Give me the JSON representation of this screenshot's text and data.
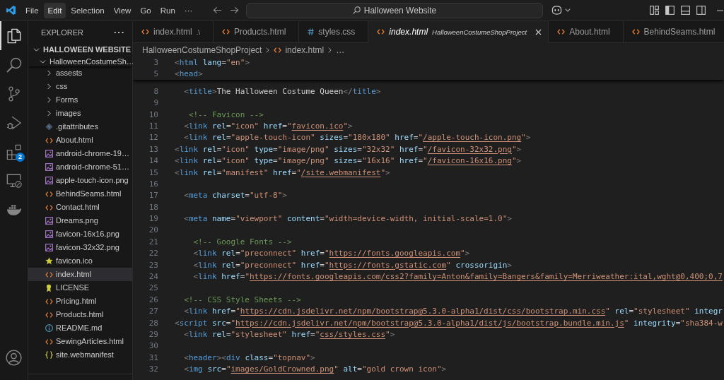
{
  "title_bar": {
    "menu": [
      {
        "label": "File",
        "selected": false
      },
      {
        "label": "Edit",
        "selected": true
      },
      {
        "label": "Selection",
        "selected": false
      },
      {
        "label": "View",
        "selected": false
      },
      {
        "label": "Go",
        "selected": false
      },
      {
        "label": "Run",
        "selected": false
      },
      {
        "label": "···",
        "selected": false
      }
    ],
    "command_center": {
      "label": "Halloween Website"
    }
  },
  "activity_bar": {
    "items": [
      {
        "kind": "explorer",
        "selected": true
      },
      {
        "kind": "search",
        "selected": false
      },
      {
        "kind": "source-control",
        "selected": false
      },
      {
        "kind": "run-debug",
        "selected": false
      },
      {
        "kind": "extensions",
        "selected": false,
        "badge": "2"
      },
      {
        "kind": "remote-explorer",
        "selected": false
      },
      {
        "kind": "docker",
        "selected": false
      }
    ]
  },
  "sidebar": {
    "title": "EXPLORER",
    "more_actions": "···",
    "tree": {
      "label": "HALLOWEEN WEBSITE",
      "kind": "workspace",
      "expanded": true,
      "children": [
        {
          "label": "HalloweenCostumeSh…",
          "kind": "folder",
          "expanded": true,
          "selected": false,
          "children": [
            {
              "label": "assests",
              "kind": "folder",
              "expanded": false,
              "selected": false
            },
            {
              "label": "css",
              "kind": "folder",
              "expanded": false,
              "selected": false
            },
            {
              "label": "Forms",
              "kind": "folder",
              "expanded": false,
              "selected": false
            },
            {
              "label": "images",
              "kind": "folder",
              "expanded": false,
              "selected": false
            },
            {
              "label": ".gitattributes",
              "kind": "git",
              "selected": false
            },
            {
              "label": "About.html",
              "kind": "html",
              "selected": false
            },
            {
              "label": "android-chrome-19…",
              "kind": "image",
              "selected": false
            },
            {
              "label": "android-chrome-51…",
              "kind": "image",
              "selected": false
            },
            {
              "label": "apple-touch-icon.png",
              "kind": "image",
              "selected": false
            },
            {
              "label": "BehindSeams.html",
              "kind": "html",
              "selected": false
            },
            {
              "label": "Contact.html",
              "kind": "html",
              "selected": false
            },
            {
              "label": "Dreams.png",
              "kind": "image",
              "selected": false
            },
            {
              "label": "favicon-16x16.png",
              "kind": "image",
              "selected": false
            },
            {
              "label": "favicon-32x32.png",
              "kind": "image",
              "selected": false
            },
            {
              "label": "favicon.ico",
              "kind": "favicon",
              "selected": false
            },
            {
              "label": "index.html",
              "kind": "html",
              "selected": true
            },
            {
              "label": "LICENSE",
              "kind": "license",
              "selected": false
            },
            {
              "label": "Pricing.html",
              "kind": "html",
              "selected": false
            },
            {
              "label": "Products.html",
              "kind": "html",
              "selected": false
            },
            {
              "label": "README.md",
              "kind": "readme",
              "selected": false
            },
            {
              "label": "SewingArticles.html",
              "kind": "html",
              "selected": false
            },
            {
              "label": "site.webmanifest",
              "kind": "manifest",
              "selected": false
            }
          ]
        }
      ]
    }
  },
  "tabs": [
    {
      "label": "index.html",
      "description": ".\\",
      "kind": "html",
      "selected": false,
      "preview": false
    },
    {
      "label": "Products.html",
      "kind": "html",
      "selected": false,
      "preview": false
    },
    {
      "label": "styles.css",
      "kind": "css",
      "selected": false,
      "preview": false
    },
    {
      "label": "index.html",
      "description": "HalloweenCostumeShopProject",
      "kind": "html",
      "selected": true,
      "preview": true
    },
    {
      "label": "About.html",
      "kind": "html",
      "selected": false,
      "preview": false
    },
    {
      "label": "BehindSeams.html",
      "kind": "html",
      "selected": false,
      "preview": false
    }
  ],
  "breadcrumb": [
    {
      "label": "HalloweenCostumeShopProject",
      "kind": "folder"
    },
    {
      "label": "index.html",
      "kind": "html"
    },
    {
      "label": "…",
      "kind": "more"
    }
  ],
  "editor": {
    "sticky_lines": [
      {
        "number": "3",
        "tokens": [
          {
            "kind": "bracket",
            "text": "<"
          },
          {
            "kind": "tag",
            "text": "html "
          },
          {
            "kind": "attribute",
            "text": "lang"
          },
          {
            "kind": "plain",
            "text": "="
          },
          {
            "kind": "string",
            "text": "\"en\""
          },
          {
            "kind": "bracket",
            "text": ">"
          }
        ]
      },
      {
        "number": "5",
        "tokens": [
          {
            "kind": "bracket",
            "text": "<"
          },
          {
            "kind": "tag",
            "text": "head"
          },
          {
            "kind": "bracket",
            "text": ">"
          }
        ]
      }
    ],
    "lines": [
      {
        "number": "8",
        "tokens": [
          {
            "kind": "bracket",
            "text": "  <"
          },
          {
            "kind": "tag",
            "text": "title"
          },
          {
            "kind": "bracket",
            "text": ">"
          },
          {
            "kind": "plain",
            "text": "The Halloween Costume Queen"
          },
          {
            "kind": "bracket",
            "text": "</"
          },
          {
            "kind": "tag",
            "text": "title"
          },
          {
            "kind": "bracket",
            "text": ">"
          }
        ]
      },
      {
        "number": "9"
      },
      {
        "number": "10",
        "tokens": [
          {
            "kind": "comment",
            "text": "   <!-- Favicon -->"
          }
        ]
      },
      {
        "number": "11",
        "tokens": [
          {
            "kind": "bracket",
            "text": "  <"
          },
          {
            "kind": "tag",
            "text": "link "
          },
          {
            "kind": "attribute",
            "text": "rel"
          },
          {
            "kind": "plain",
            "text": "="
          },
          {
            "kind": "string",
            "text": "\"icon\" "
          },
          {
            "kind": "attribute",
            "text": "href"
          },
          {
            "kind": "plain",
            "text": "="
          },
          {
            "kind": "string",
            "text": "\""
          },
          {
            "kind": "link",
            "text": "favicon.ico"
          },
          {
            "kind": "string",
            "text": "\""
          },
          {
            "kind": "bracket",
            "text": ">"
          }
        ]
      },
      {
        "number": "12",
        "tokens": [
          {
            "kind": "bracket",
            "text": "  <"
          },
          {
            "kind": "tag",
            "text": "link "
          },
          {
            "kind": "attribute",
            "text": "rel"
          },
          {
            "kind": "plain",
            "text": "="
          },
          {
            "kind": "string",
            "text": "\"apple-touch-icon\" "
          },
          {
            "kind": "attribute",
            "text": "sizes"
          },
          {
            "kind": "plain",
            "text": "="
          },
          {
            "kind": "string",
            "text": "\"180x180\" "
          },
          {
            "kind": "attribute",
            "text": "href"
          },
          {
            "kind": "plain",
            "text": "="
          },
          {
            "kind": "string",
            "text": "\""
          },
          {
            "kind": "link",
            "text": "/apple-touch-icon.png"
          },
          {
            "kind": "string",
            "text": "\""
          },
          {
            "kind": "bracket",
            "text": ">"
          }
        ]
      },
      {
        "number": "13",
        "tokens": [
          {
            "kind": "bracket",
            "text": "<"
          },
          {
            "kind": "tag",
            "text": "link "
          },
          {
            "kind": "attribute",
            "text": "rel"
          },
          {
            "kind": "plain",
            "text": "="
          },
          {
            "kind": "string",
            "text": "\"icon\" "
          },
          {
            "kind": "attribute",
            "text": "type"
          },
          {
            "kind": "plain",
            "text": "="
          },
          {
            "kind": "string",
            "text": "\"image/png\" "
          },
          {
            "kind": "attribute",
            "text": "sizes"
          },
          {
            "kind": "plain",
            "text": "="
          },
          {
            "kind": "string",
            "text": "\"32x32\" "
          },
          {
            "kind": "attribute",
            "text": "href"
          },
          {
            "kind": "plain",
            "text": "="
          },
          {
            "kind": "string",
            "text": "\""
          },
          {
            "kind": "link",
            "text": "/favicon-32x32.png"
          },
          {
            "kind": "string",
            "text": "\""
          },
          {
            "kind": "bracket",
            "text": ">"
          }
        ]
      },
      {
        "number": "14",
        "tokens": [
          {
            "kind": "bracket",
            "text": "<"
          },
          {
            "kind": "tag",
            "text": "link "
          },
          {
            "kind": "attribute",
            "text": "rel"
          },
          {
            "kind": "plain",
            "text": "="
          },
          {
            "kind": "string",
            "text": "\"icon\" "
          },
          {
            "kind": "attribute",
            "text": "type"
          },
          {
            "kind": "plain",
            "text": "="
          },
          {
            "kind": "string",
            "text": "\"image/png\" "
          },
          {
            "kind": "attribute",
            "text": "sizes"
          },
          {
            "kind": "plain",
            "text": "="
          },
          {
            "kind": "string",
            "text": "\"16x16\" "
          },
          {
            "kind": "attribute",
            "text": "href"
          },
          {
            "kind": "plain",
            "text": "="
          },
          {
            "kind": "string",
            "text": "\""
          },
          {
            "kind": "link",
            "text": "/favicon-16x16.png"
          },
          {
            "kind": "string",
            "text": "\""
          },
          {
            "kind": "bracket",
            "text": ">"
          }
        ]
      },
      {
        "number": "15",
        "tokens": [
          {
            "kind": "bracket",
            "text": "<"
          },
          {
            "kind": "tag",
            "text": "link "
          },
          {
            "kind": "attribute",
            "text": "rel"
          },
          {
            "kind": "plain",
            "text": "="
          },
          {
            "kind": "string",
            "text": "\"manifest\" "
          },
          {
            "kind": "attribute",
            "text": "href"
          },
          {
            "kind": "plain",
            "text": "="
          },
          {
            "kind": "string",
            "text": "\""
          },
          {
            "kind": "link",
            "text": "/site.webmanifest"
          },
          {
            "kind": "string",
            "text": "\""
          },
          {
            "kind": "bracket",
            "text": ">"
          }
        ]
      },
      {
        "number": "16"
      },
      {
        "number": "17",
        "tokens": [
          {
            "kind": "bracket",
            "text": "  <"
          },
          {
            "kind": "tag",
            "text": "meta "
          },
          {
            "kind": "attribute",
            "text": "charset"
          },
          {
            "kind": "plain",
            "text": "="
          },
          {
            "kind": "string",
            "text": "\"utf-8\""
          },
          {
            "kind": "bracket",
            "text": ">"
          }
        ]
      },
      {
        "number": "18"
      },
      {
        "number": "19",
        "tokens": [
          {
            "kind": "bracket",
            "text": "  <"
          },
          {
            "kind": "tag",
            "text": "meta "
          },
          {
            "kind": "attribute",
            "text": "name"
          },
          {
            "kind": "plain",
            "text": "="
          },
          {
            "kind": "string",
            "text": "\"viewport\" "
          },
          {
            "kind": "attribute",
            "text": "content"
          },
          {
            "kind": "plain",
            "text": "="
          },
          {
            "kind": "string",
            "text": "\"width=device-width, initial-scale=1.0\""
          },
          {
            "kind": "bracket",
            "text": ">"
          }
        ]
      },
      {
        "number": "20"
      },
      {
        "number": "21",
        "tokens": [
          {
            "kind": "comment",
            "text": "    <!-- Google Fonts -->"
          }
        ]
      },
      {
        "number": "22",
        "tokens": [
          {
            "kind": "bracket",
            "text": "    <"
          },
          {
            "kind": "tag",
            "text": "link "
          },
          {
            "kind": "attribute",
            "text": "rel"
          },
          {
            "kind": "plain",
            "text": "="
          },
          {
            "kind": "string",
            "text": "\"preconnect\" "
          },
          {
            "kind": "attribute",
            "text": "href"
          },
          {
            "kind": "plain",
            "text": "="
          },
          {
            "kind": "string",
            "text": "\""
          },
          {
            "kind": "link",
            "text": "https://fonts.googleapis.com"
          },
          {
            "kind": "string",
            "text": "\""
          },
          {
            "kind": "bracket",
            "text": ">"
          }
        ]
      },
      {
        "number": "23",
        "tokens": [
          {
            "kind": "bracket",
            "text": "    <"
          },
          {
            "kind": "tag",
            "text": "link "
          },
          {
            "kind": "attribute",
            "text": "rel"
          },
          {
            "kind": "plain",
            "text": "="
          },
          {
            "kind": "string",
            "text": "\"preconnect\" "
          },
          {
            "kind": "attribute",
            "text": "href"
          },
          {
            "kind": "plain",
            "text": "="
          },
          {
            "kind": "string",
            "text": "\""
          },
          {
            "kind": "link",
            "text": "https://fonts.gstatic.com"
          },
          {
            "kind": "string",
            "text": "\" "
          },
          {
            "kind": "attribute",
            "text": "crossorigin"
          },
          {
            "kind": "bracket",
            "text": ">"
          }
        ]
      },
      {
        "number": "24",
        "tokens": [
          {
            "kind": "bracket",
            "text": "    <"
          },
          {
            "kind": "tag",
            "text": "link "
          },
          {
            "kind": "attribute",
            "text": "href"
          },
          {
            "kind": "plain",
            "text": "="
          },
          {
            "kind": "string",
            "text": "\""
          },
          {
            "kind": "link",
            "text": "https://fonts.googleapis.com/css2?family=Anton&family=Bangers&family=Merriweather:ital,wght@0,400;0,7"
          }
        ]
      },
      {
        "number": "25"
      },
      {
        "number": "26",
        "tokens": [
          {
            "kind": "comment",
            "text": "  <!-- CSS Style Sheets -->"
          }
        ]
      },
      {
        "number": "27",
        "tokens": [
          {
            "kind": "bracket",
            "text": "  <"
          },
          {
            "kind": "tag",
            "text": "link "
          },
          {
            "kind": "attribute",
            "text": "href"
          },
          {
            "kind": "plain",
            "text": "="
          },
          {
            "kind": "string",
            "text": "\""
          },
          {
            "kind": "link",
            "text": "https://cdn.jsdelivr.net/npm/bootstrap@5.3.0-alpha1/dist/css/bootstrap.min.css"
          },
          {
            "kind": "string",
            "text": "\" "
          },
          {
            "kind": "attribute",
            "text": "rel"
          },
          {
            "kind": "plain",
            "text": "="
          },
          {
            "kind": "string",
            "text": "\"stylesheet\" "
          },
          {
            "kind": "attribute",
            "text": "integr"
          }
        ]
      },
      {
        "number": "28",
        "tokens": [
          {
            "kind": "bracket",
            "text": "<"
          },
          {
            "kind": "tag",
            "text": "script "
          },
          {
            "kind": "attribute",
            "text": "src"
          },
          {
            "kind": "plain",
            "text": "="
          },
          {
            "kind": "string",
            "text": "\""
          },
          {
            "kind": "link",
            "text": "https://cdn.jsdelivr.net/npm/bootstrap@5.3.0-alpha1/dist/js/bootstrap.bundle.min.js"
          },
          {
            "kind": "string",
            "text": "\" "
          },
          {
            "kind": "attribute",
            "text": "integrity"
          },
          {
            "kind": "plain",
            "text": "="
          },
          {
            "kind": "string",
            "text": "\"sha384-w"
          }
        ]
      },
      {
        "number": "29",
        "tokens": [
          {
            "kind": "bracket",
            "text": "  <"
          },
          {
            "kind": "tag",
            "text": "link "
          },
          {
            "kind": "attribute",
            "text": "rel"
          },
          {
            "kind": "plain",
            "text": "="
          },
          {
            "kind": "string",
            "text": "\"stylesheet\" "
          },
          {
            "kind": "attribute",
            "text": "href"
          },
          {
            "kind": "plain",
            "text": "="
          },
          {
            "kind": "string",
            "text": "\""
          },
          {
            "kind": "link",
            "text": "css/styles.css"
          },
          {
            "kind": "string",
            "text": "\""
          },
          {
            "kind": "bracket",
            "text": ">"
          }
        ]
      },
      {
        "number": "30"
      },
      {
        "number": "31",
        "tokens": [
          {
            "kind": "bracket",
            "text": "  <"
          },
          {
            "kind": "tag",
            "text": "header"
          },
          {
            "kind": "bracket",
            "text": "><"
          },
          {
            "kind": "tag",
            "text": "div "
          },
          {
            "kind": "attribute",
            "text": "class"
          },
          {
            "kind": "plain",
            "text": "="
          },
          {
            "kind": "string",
            "text": "\"topnav\""
          },
          {
            "kind": "bracket",
            "text": ">"
          }
        ]
      },
      {
        "number": "32",
        "tokens": [
          {
            "kind": "bracket",
            "text": "  <"
          },
          {
            "kind": "tag",
            "text": "img "
          },
          {
            "kind": "attribute",
            "text": "src"
          },
          {
            "kind": "plain",
            "text": "="
          },
          {
            "kind": "string",
            "text": "\""
          },
          {
            "kind": "link",
            "text": "images/GoldCrowned.png"
          },
          {
            "kind": "string",
            "text": "\" "
          },
          {
            "kind": "attribute",
            "text": "alt"
          },
          {
            "kind": "plain",
            "text": "="
          },
          {
            "kind": "string",
            "text": "\"gold crown icon\""
          },
          {
            "kind": "bracket",
            "text": ">"
          }
        ]
      }
    ]
  }
}
